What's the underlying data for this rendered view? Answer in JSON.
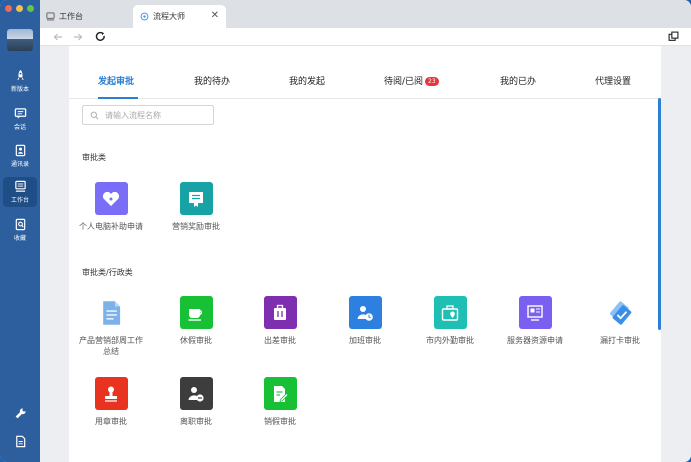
{
  "window": {
    "traffic_colors": [
      "#ec6a5e",
      "#f4bf4f",
      "#61c554"
    ]
  },
  "sidebar": {
    "items": [
      {
        "label": "新版本",
        "icon": "rocket-icon"
      },
      {
        "label": "会话",
        "icon": "chat-icon"
      },
      {
        "label": "通讯录",
        "icon": "contacts-icon"
      },
      {
        "label": "工作台",
        "icon": "workbench-icon",
        "active": true
      },
      {
        "label": "收藏",
        "icon": "favorite-icon"
      }
    ],
    "bottom_icons": [
      "wrench-icon",
      "file-icon"
    ]
  },
  "browser": {
    "tabs": [
      {
        "label": "工作台",
        "icon": "workbench-icon"
      },
      {
        "label": "流程大师",
        "icon": "flow-icon",
        "active": true
      }
    ],
    "close_glyph": "✕"
  },
  "topnav": {
    "items": [
      {
        "label": "发起审批",
        "active": true
      },
      {
        "label": "我的待办"
      },
      {
        "label": "我的发起"
      },
      {
        "label": "待阅/已阅",
        "badge": "23"
      },
      {
        "label": "我的已办"
      },
      {
        "label": "代理设置"
      }
    ]
  },
  "search": {
    "placeholder": "请输入流程名称",
    "value": ""
  },
  "sections": [
    {
      "title": "审批类",
      "apps": [
        {
          "label": "个人电脑补助申请",
          "color": "#7b6ef6",
          "icon": "heart-tag-icon"
        },
        {
          "label": "营销奖励审批",
          "color": "#17a2a6",
          "icon": "award-icon"
        }
      ]
    },
    {
      "title": "审批类/行政类",
      "apps": [
        {
          "label": "产品营销部周工作总结",
          "color": "#7db1ea",
          "icon": "document-icon"
        },
        {
          "label": "休假审批",
          "color": "#18c036",
          "icon": "coffee-icon"
        },
        {
          "label": "出差审批",
          "color": "#7e2fb0",
          "icon": "luggage-icon"
        },
        {
          "label": "加班审批",
          "color": "#2d7fe0",
          "icon": "overtime-icon"
        },
        {
          "label": "市内外勤审批",
          "color": "#1fbfb3",
          "icon": "field-work-icon"
        },
        {
          "label": "服务器资源申请",
          "color": "#7a5ff0",
          "icon": "server-request-icon"
        },
        {
          "label": "漏打卡审批",
          "color": "#3a8ee8",
          "icon": "check-in-icon"
        },
        {
          "label": "用章审批",
          "color": "#e8331e",
          "icon": "seal-icon"
        },
        {
          "label": "离职审批",
          "color": "#3d3d3d",
          "icon": "resign-icon"
        },
        {
          "label": "销假审批",
          "color": "#18c036",
          "icon": "leave-cancel-icon"
        }
      ]
    }
  ]
}
